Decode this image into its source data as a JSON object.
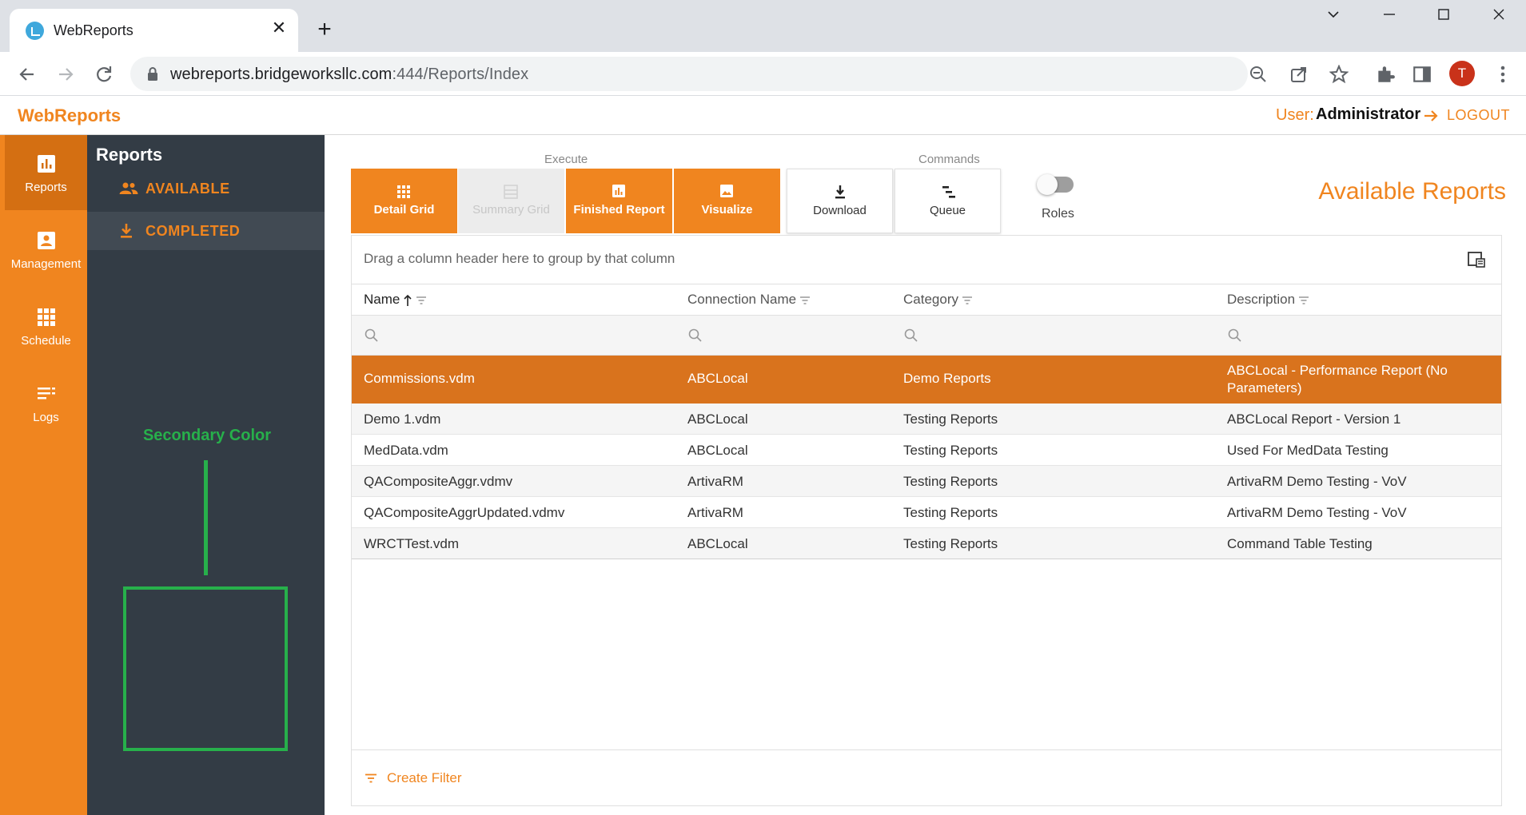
{
  "browser": {
    "tab_title": "WebReports",
    "url_host": "webreports.bridgeworksllc.com",
    "url_path": ":444/Reports/Index",
    "profile_initial": "T"
  },
  "app": {
    "brand": "WebReports",
    "user_label": "User:",
    "user_name": "Administrator",
    "logout_label": "LOGOUT",
    "primary_color": "#f0851f",
    "secondary_color": "#333c45"
  },
  "rail": {
    "items": [
      {
        "label": "Reports",
        "icon": "bar-chart-icon"
      },
      {
        "label": "Management",
        "icon": "account-box-icon"
      },
      {
        "label": "Schedule",
        "icon": "grid-icon"
      },
      {
        "label": "Logs",
        "icon": "list-icon"
      }
    ]
  },
  "sidebar": {
    "title": "Reports",
    "items": [
      {
        "label": "AVAILABLE",
        "icon": "people-icon"
      },
      {
        "label": "COMPLETED",
        "icon": "download-icon"
      }
    ],
    "annotation": "Secondary Color"
  },
  "toolbar": {
    "execute_label": "Execute",
    "commands_label": "Commands",
    "buttons": [
      {
        "label": "Detail Grid",
        "icon": "grid-icon"
      },
      {
        "label": "Summary Grid",
        "icon": "table-icon"
      },
      {
        "label": "Finished Report",
        "icon": "chart-icon"
      },
      {
        "label": "Visualize",
        "icon": "image-icon"
      },
      {
        "label": "Download",
        "icon": "download-icon"
      },
      {
        "label": "Queue",
        "icon": "queue-icon"
      }
    ],
    "roles_label": "Roles"
  },
  "page_title": "Available Reports",
  "grid": {
    "group_hint": "Drag a column header here to group by that column",
    "columns": [
      "Name",
      "Connection Name",
      "Category",
      "Description"
    ],
    "rows": [
      [
        "Commissions.vdm",
        "ABCLocal",
        "Demo Reports",
        "ABCLocal - Performance Report (No Parameters)"
      ],
      [
        "Demo 1.vdm",
        "ABCLocal",
        "Testing Reports",
        "ABCLocal Report - Version 1"
      ],
      [
        "MedData.vdm",
        "ABCLocal",
        "Testing Reports",
        "Used For MedData Testing"
      ],
      [
        "QACompositeAggr.vdmv",
        "ArtivaRM",
        "Testing Reports",
        "ArtivaRM Demo Testing - VoV"
      ],
      [
        "QACompositeAggrUpdated.vdmv",
        "ArtivaRM",
        "Testing Reports",
        "ArtivaRM Demo Testing - VoV"
      ],
      [
        "WRCTTest.vdm",
        "ABCLocal",
        "Testing Reports",
        "Command Table Testing"
      ]
    ],
    "create_filter": "Create Filter"
  }
}
